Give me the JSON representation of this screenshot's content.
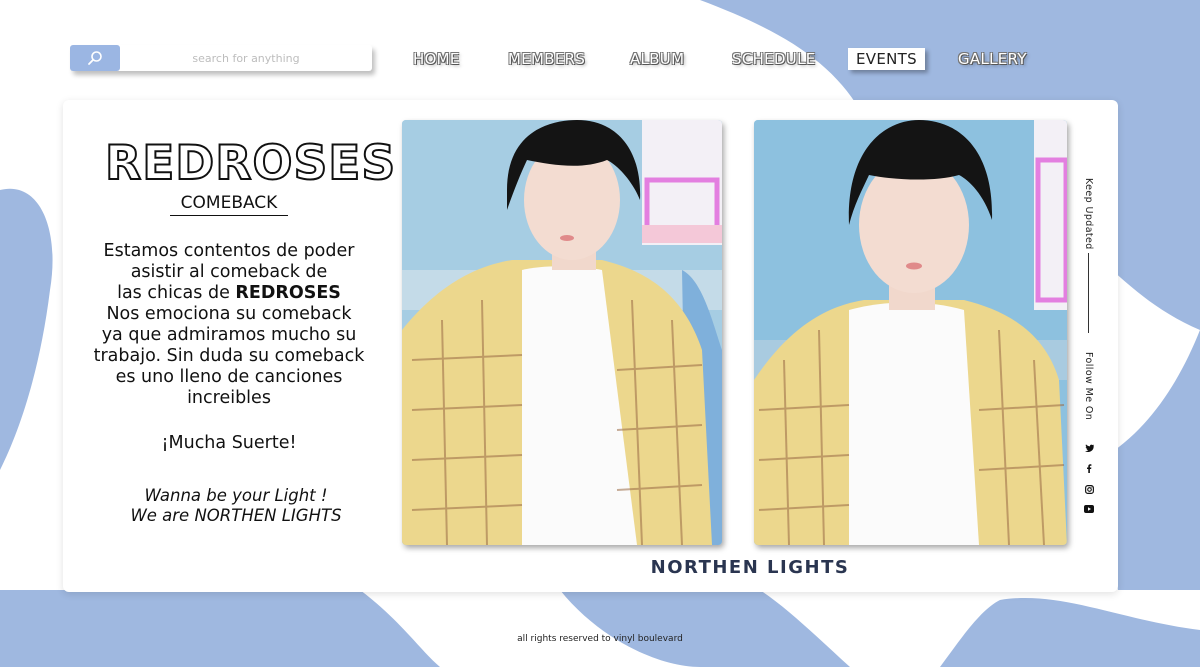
{
  "search": {
    "placeholder": "search for anything",
    "icon": "search-icon"
  },
  "nav": {
    "items": [
      {
        "label": "HOME",
        "active": false
      },
      {
        "label": "MEMBERS",
        "active": false
      },
      {
        "label": "ALBUM",
        "active": false
      },
      {
        "label": "SCHEDULE",
        "active": false
      },
      {
        "label": "EVENTS",
        "active": true
      },
      {
        "label": "GALLERY",
        "active": false
      }
    ]
  },
  "article": {
    "title": "REDROSES",
    "subtitle": "COMEBACK",
    "body_lines": [
      "Estamos contentos de poder",
      "asistir al comeback de",
      "las chicas de",
      "REDROSES",
      "Nos emociona su comeback",
      "ya que admiramos mucho su",
      "trabajo. Sin duda su comeback",
      "es uno lleno de canciones",
      "increibles"
    ],
    "closing": "¡Mucha Suerte!",
    "slogan_1": "Wanna be your Light !",
    "slogan_2": "We are NORTHEN LIGHTS"
  },
  "gallery": {
    "caption": "NORTHEN LIGHTS"
  },
  "sidebar": {
    "keep_updated": "Keep Updated",
    "follow_me": "Follow Me On",
    "social_icons": [
      "twitter-icon",
      "facebook-icon",
      "instagram-icon",
      "youtube-icon"
    ]
  },
  "footer": {
    "text": "all rights reserved to vinyl boulevard"
  },
  "colors": {
    "accent": "#9bb6e3",
    "caption": "#2a3550"
  }
}
